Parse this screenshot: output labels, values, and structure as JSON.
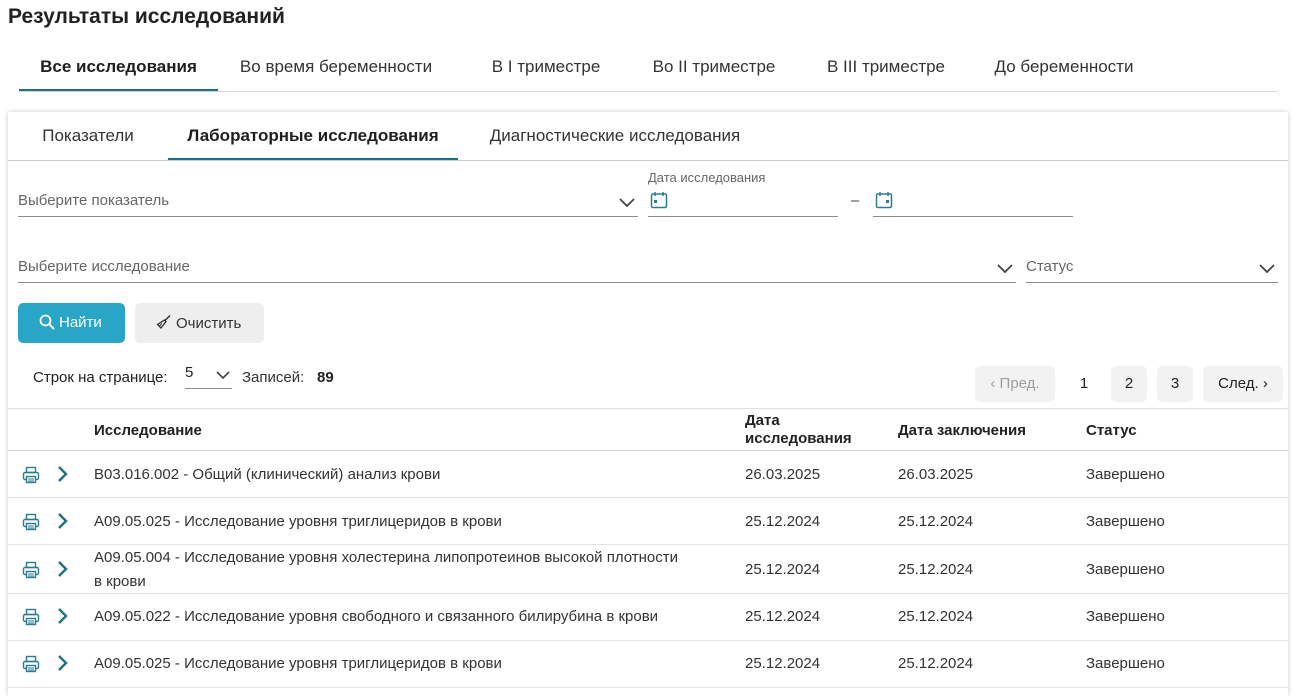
{
  "page": {
    "title": "Результаты исследований"
  },
  "top_tabs": [
    {
      "label": "Все исследования",
      "active": true
    },
    {
      "label": "Во время беременности"
    },
    {
      "label": "В I триместре"
    },
    {
      "label": "Во II триместре"
    },
    {
      "label": "В III триместре"
    },
    {
      "label": "До беременности"
    }
  ],
  "sub_tabs": [
    {
      "label": "Показатели"
    },
    {
      "label": "Лабораторные исследования",
      "active": true
    },
    {
      "label": "Диагностические исследования"
    }
  ],
  "filters": {
    "indicator_placeholder": "Выберите показатель",
    "date_label": "Дата исследования",
    "date_separator": "–",
    "study_placeholder": "Выберите исследование",
    "status_placeholder": "Статус"
  },
  "buttons": {
    "find": "Найти",
    "clear": "Очистить"
  },
  "pagination": {
    "rows_label": "Строк на странице:",
    "rows_value": "5",
    "records_label": "Записей:",
    "records_count": "89",
    "prev": "Пред.",
    "next": "След.",
    "pages": [
      "1",
      "2",
      "3"
    ]
  },
  "table": {
    "headers": {
      "study": "Исследование",
      "date_study_line1": "Дата",
      "date_study_line2": "исследования",
      "date_conclusion": "Дата заключения",
      "status": "Статус"
    },
    "rows": [
      {
        "study": "B03.016.002 - Общий (клинический) анализ крови",
        "date_study": "26.03.2025",
        "date_conclusion": "26.03.2025",
        "status": "Завершено"
      },
      {
        "study": "A09.05.025 - Исследование уровня триглицеридов в крови",
        "date_study": "25.12.2024",
        "date_conclusion": "25.12.2024",
        "status": "Завершено"
      },
      {
        "study_line1": "A09.05.004 - Исследование уровня холестерина липопротеинов высокой плотности",
        "study_line2": "в крови",
        "date_study": "25.12.2024",
        "date_conclusion": "25.12.2024",
        "status": "Завершено"
      },
      {
        "study": "A09.05.022 - Исследование уровня свободного и связанного билирубина в крови",
        "date_study": "25.12.2024",
        "date_conclusion": "25.12.2024",
        "status": "Завершено"
      },
      {
        "study": "A09.05.025 - Исследование уровня триглицеридов в крови",
        "date_study": "25.12.2024",
        "date_conclusion": "25.12.2024",
        "status": "Завершено"
      }
    ]
  },
  "colors": {
    "accent": "#29a6c5",
    "tab_underline": "#1e6f86",
    "icon": "#2b7c90"
  },
  "icons": {
    "print": "printer-icon",
    "expand": "chevron-right-icon",
    "calendar": "calendar-icon",
    "search": "search-icon",
    "clear": "broom-icon"
  }
}
